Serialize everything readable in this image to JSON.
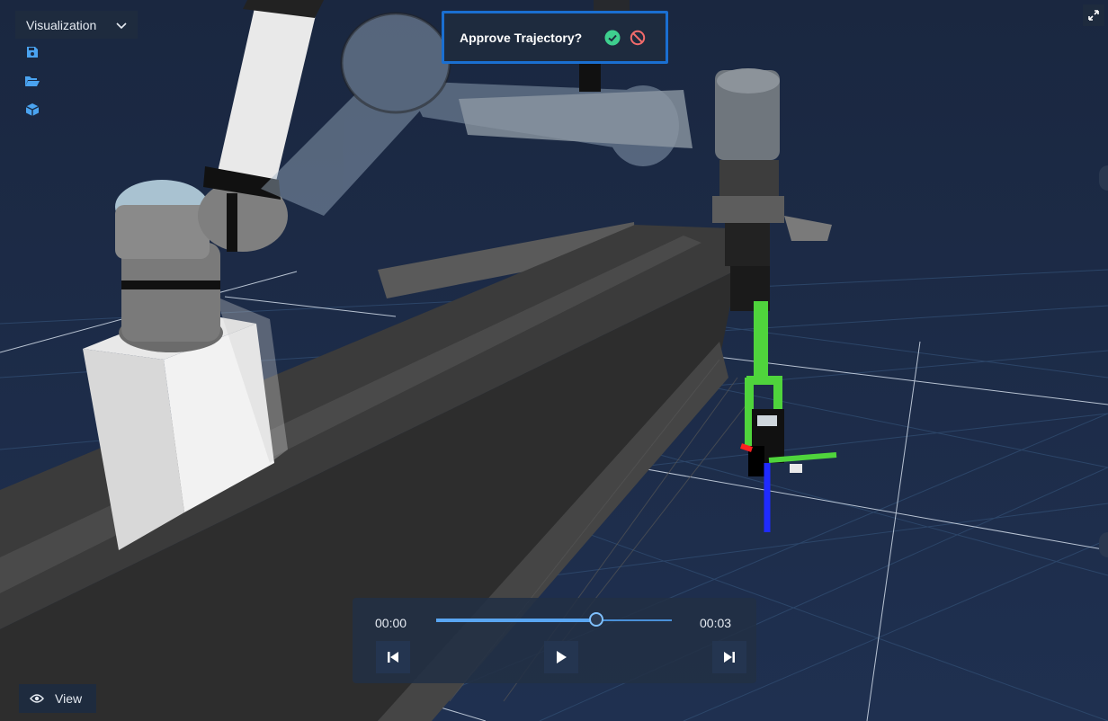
{
  "toolbar": {
    "dropdown_label": "Visualization",
    "tools": [
      {
        "icon": "save-icon"
      },
      {
        "icon": "folder-open-icon"
      },
      {
        "icon": "cube-icon"
      }
    ]
  },
  "approval": {
    "label": "Approve Trajectory?",
    "approve_icon": "check-circle-icon",
    "reject_icon": "ban-icon",
    "approve_color": "#3ecf8e",
    "reject_color": "#f26b6b"
  },
  "player": {
    "start_time": "00:00",
    "end_time": "00:03",
    "progress": 0.68
  },
  "view_button": {
    "label": "View",
    "icon": "eye-icon"
  },
  "fullscreen": {
    "icon": "expand-icon"
  },
  "colors": {
    "background": "#1b2a44",
    "accent": "#1a6fd1",
    "panel": "#1e2b3e",
    "tool_icon": "#4aa3f0"
  }
}
